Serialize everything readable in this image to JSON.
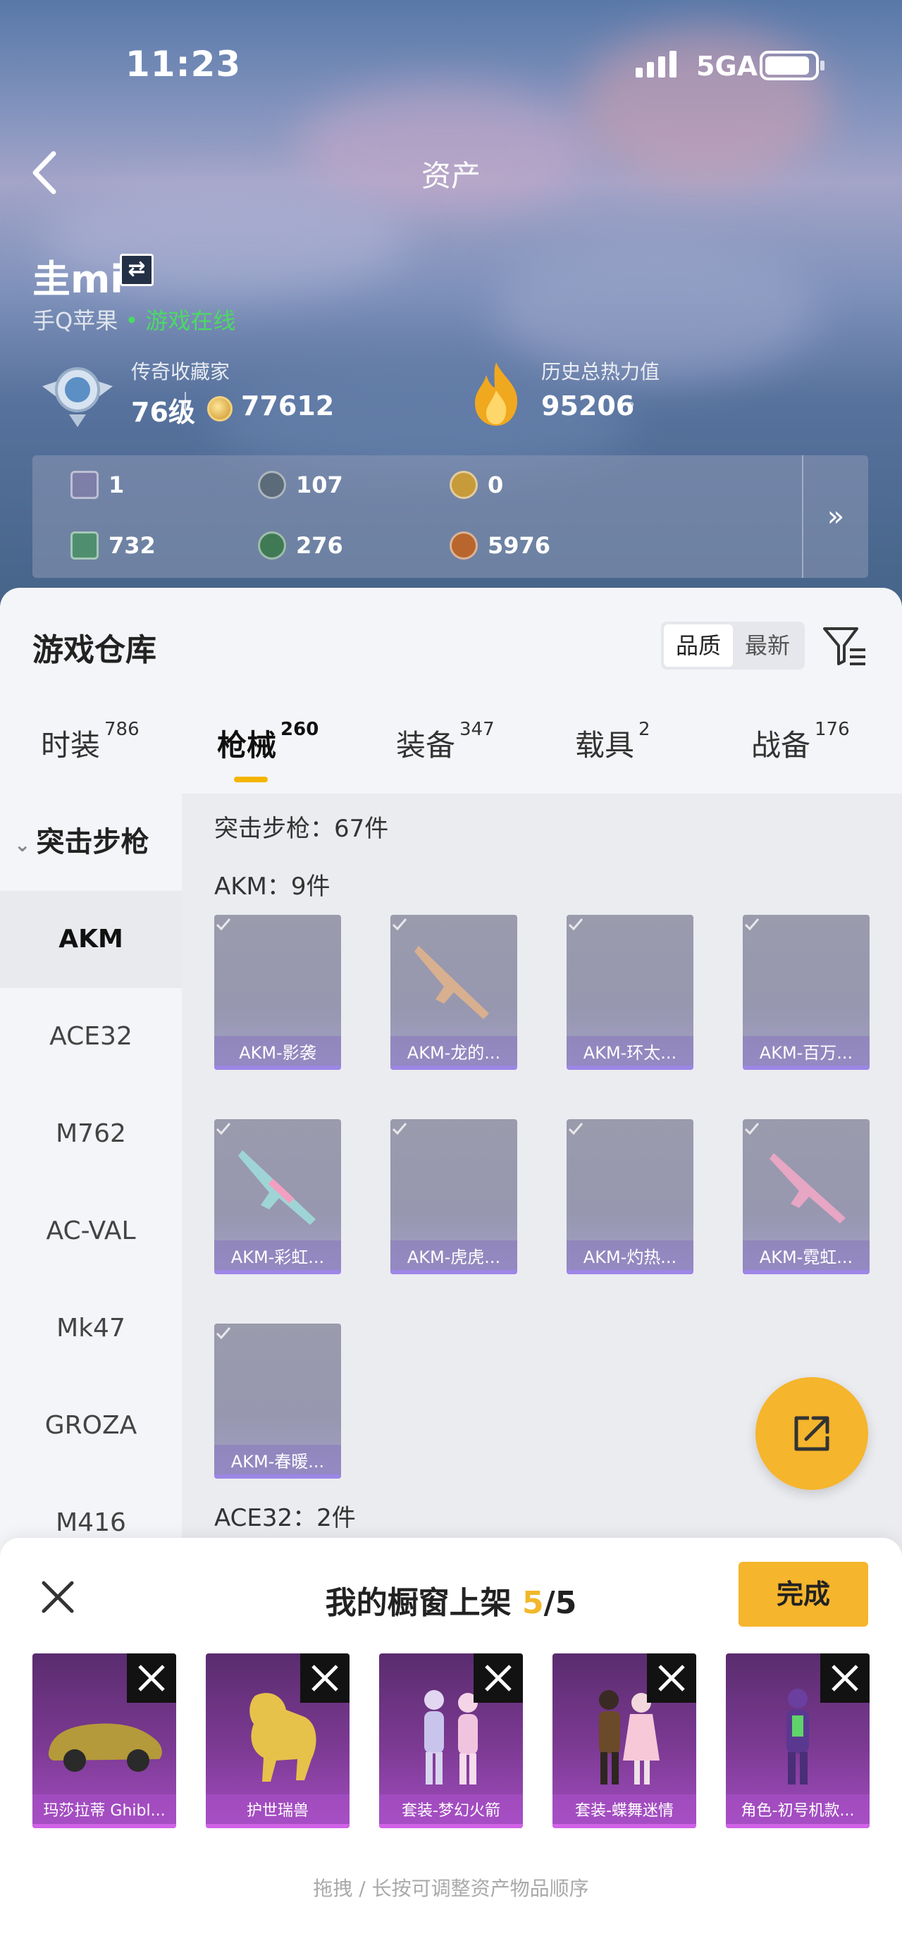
{
  "status_bar": {
    "time": "11:23",
    "network": "5GA"
  },
  "nav": {
    "title": "资产"
  },
  "user": {
    "name": "圭mi",
    "platform": "手Q苹果",
    "online": "• 游戏在线"
  },
  "stats": {
    "collector_label": "传奇收藏家",
    "level": "76级",
    "points": "77612",
    "heat_label": "历史总热力值",
    "heat_value": "95206",
    "help": "?"
  },
  "currencies": [
    {
      "icon": "card-icon",
      "value": "1",
      "color": "#7d7fa8"
    },
    {
      "icon": "silver-coin-icon",
      "value": "107",
      "color": "#5b6b7a"
    },
    {
      "icon": "gold-coin-icon",
      "value": "0",
      "color": "#c79b3a"
    },
    {
      "icon": "green-ticket-icon",
      "value": "732",
      "color": "#4f8f6f"
    },
    {
      "icon": "green-orb-icon",
      "value": "276",
      "color": "#3f7a55"
    },
    {
      "icon": "bronze-coin-icon",
      "value": "5976",
      "color": "#b8662e"
    }
  ],
  "currency_more": "»",
  "warehouse": {
    "title": "游戏仓库",
    "sort": [
      "品质",
      "最新"
    ],
    "tabs": [
      {
        "label": "时装",
        "count": "786"
      },
      {
        "label": "枪械",
        "count": "260"
      },
      {
        "label": "装备",
        "count": "347"
      },
      {
        "label": "载具",
        "count": "2"
      },
      {
        "label": "战备",
        "count": "176"
      }
    ],
    "active_tab": "枪械",
    "sidebar_head": "突击步枪",
    "sidebar_items": [
      "AKM",
      "ACE32",
      "M762",
      "AC-VAL",
      "Mk47",
      "GROZA",
      "M416"
    ],
    "category_summary": "突击步枪：67件",
    "group1_title": "AKM：9件",
    "items": [
      "AKM-影袭",
      "AKM-龙的...",
      "AKM-环太...",
      "AKM-百万...",
      "AKM-彩虹...",
      "AKM-虎虎...",
      "AKM-灼热...",
      "AKM-霓虹...",
      "AKM-春暖..."
    ],
    "group2_title": "ACE32：2件"
  },
  "showcase": {
    "title": "我的橱窗上架",
    "count": "5",
    "total": "/5",
    "done": "完成",
    "items": [
      "玛莎拉蒂 Ghibl...",
      "护世瑞兽",
      "套装-梦幻火箭",
      "套装-蝶舞迷情",
      "角色-初号机款..."
    ],
    "hint": "拖拽 / 长按可调整资产物品顺序"
  },
  "accent_color": "#f5b52c"
}
